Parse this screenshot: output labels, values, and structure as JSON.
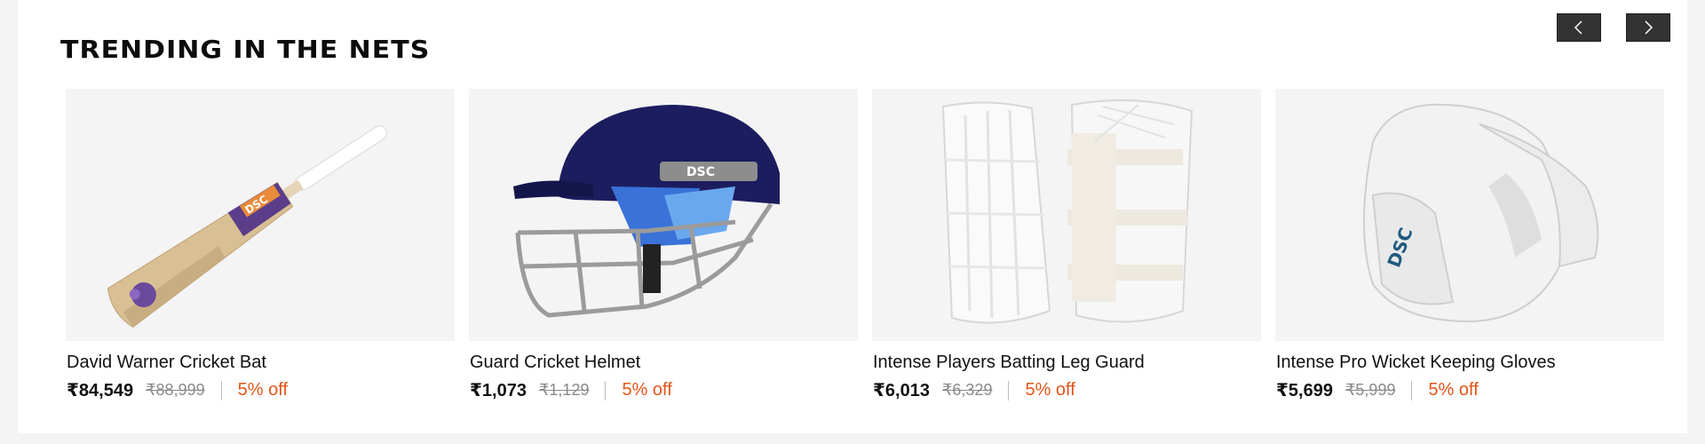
{
  "section": {
    "title": "TRENDING IN THE NETS"
  },
  "carousel": {
    "prev_icon": "chevron-left-icon",
    "next_icon": "chevron-right-icon"
  },
  "colors": {
    "discount": "#e2561a",
    "nav_button": "#333333",
    "card_bg": "#f4f4f4"
  },
  "products": [
    {
      "name": "David Warner Cricket Bat",
      "price": "₹84,549",
      "mrp": "₹88,999",
      "discount": "5% off",
      "image": "cricket-bat-image"
    },
    {
      "name": "Guard Cricket Helmet",
      "price": "₹1,073",
      "mrp": "₹1,129",
      "discount": "5% off",
      "image": "cricket-helmet-image"
    },
    {
      "name": "Intense Players Batting Leg Guard",
      "price": "₹6,013",
      "mrp": "₹6,329",
      "discount": "5% off",
      "image": "leg-guard-image"
    },
    {
      "name": "Intense Pro Wicket Keeping Gloves",
      "price": "₹5,699",
      "mrp": "₹5,999",
      "discount": "5% off",
      "image": "keeping-gloves-image"
    }
  ]
}
